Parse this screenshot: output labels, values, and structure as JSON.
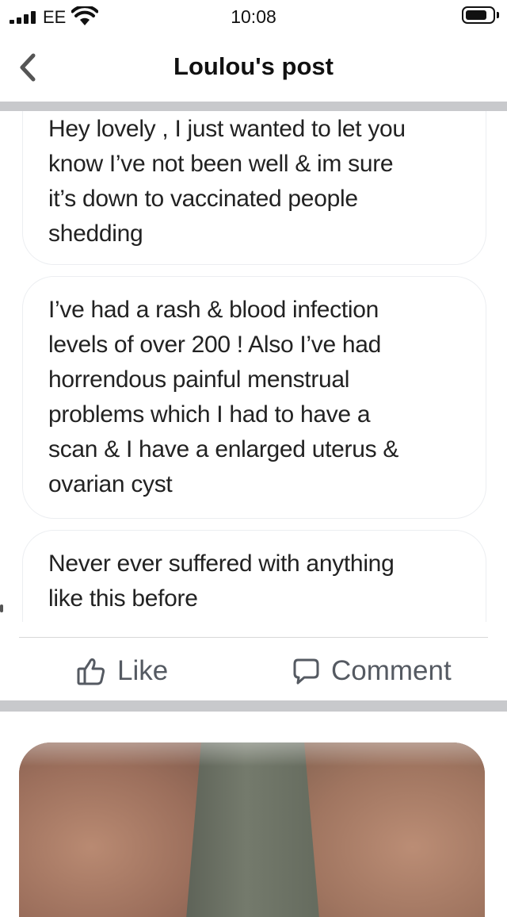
{
  "status_bar": {
    "carrier": "EE",
    "time": "10:08",
    "signal_icon": "cellular-signal-icon",
    "wifi_icon": "wifi-icon",
    "battery_icon": "battery-icon",
    "battery_level": 0.75
  },
  "nav": {
    "back_icon": "chevron-left-icon",
    "title": "Loulou's post"
  },
  "messages": [
    {
      "lines": [
        "Hey lovely , I just wanted to let you",
        "know I’ve not been well & im sure",
        "it’s down to vaccinated people",
        "shedding"
      ]
    },
    {
      "lines": [
        "I’ve had a rash & blood infection",
        "levels of over 200 ! Also I’ve had",
        "horrendous painful menstrual",
        "problems which I had to have a",
        "scan & I have a enlarged uterus &",
        "ovarian cyst"
      ]
    },
    {
      "lines": [
        "Never ever suffered with anything",
        "like this before"
      ]
    }
  ],
  "actions": {
    "like_label": "Like",
    "like_icon": "thumbs-up-icon",
    "comment_label": "Comment",
    "comment_icon": "comment-bubble-icon"
  },
  "colors": {
    "divider": "#c8c9cc",
    "action_text": "#555a62",
    "bubble_border": "#eceef1"
  }
}
